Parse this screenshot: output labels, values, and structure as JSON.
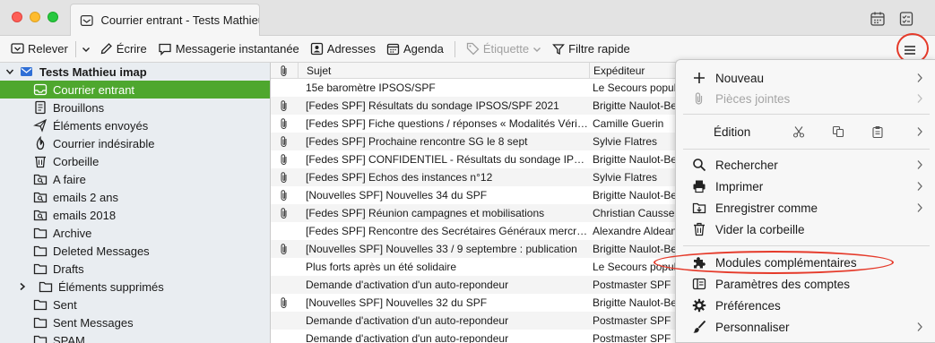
{
  "window": {
    "tab_title": "Courrier entrant - Tests Mathieu"
  },
  "toolbar": {
    "relever": "Relever",
    "ecrire": "Écrire",
    "messagerie": "Messagerie instantanée",
    "adresses": "Adresses",
    "agenda": "Agenda",
    "etiquette": "Étiquette",
    "filtre": "Filtre rapide"
  },
  "sidebar": {
    "account": "Tests Mathieu imap",
    "folders": [
      {
        "label": "Courrier entrant",
        "icon": "inbox-icon"
      },
      {
        "label": "Brouillons",
        "icon": "drafts-icon"
      },
      {
        "label": "Éléments envoyés",
        "icon": "sent-icon"
      },
      {
        "label": "Courrier indésirable",
        "icon": "junk-icon"
      },
      {
        "label": "Corbeille",
        "icon": "trash-icon"
      },
      {
        "label": "A faire",
        "icon": "saved-search-icon"
      },
      {
        "label": "emails 2 ans",
        "icon": "saved-search-icon"
      },
      {
        "label": "emails 2018",
        "icon": "saved-search-icon"
      },
      {
        "label": "Archive",
        "icon": "folder-icon"
      },
      {
        "label": "Deleted Messages",
        "icon": "folder-icon"
      },
      {
        "label": "Drafts",
        "icon": "folder-icon"
      },
      {
        "label": "Éléments supprimés",
        "icon": "folder-icon"
      },
      {
        "label": "Sent",
        "icon": "folder-icon"
      },
      {
        "label": "Sent Messages",
        "icon": "folder-icon"
      },
      {
        "label": "SPAM",
        "icon": "folder-icon"
      }
    ]
  },
  "list": {
    "col_subject": "Sujet",
    "col_from": "Expéditeur",
    "rows": [
      {
        "subject": "15e baromètre IPSOS/SPF",
        "from": "Le Secours populaire",
        "att": false
      },
      {
        "subject": "[Fedes SPF] Résultats du sondage IPSOS/SPF 2021",
        "from": "Brigitte Naulot-Bernard",
        "att": true
      },
      {
        "subject": "[Fedes SPF] Fiche questions / réponses « Modalités Vérification",
        "from": "Camille Guerin",
        "att": true
      },
      {
        "subject": "[Fedes SPF] Prochaine rencontre SG le 8 sept",
        "from": "Sylvie Flatres",
        "att": true
      },
      {
        "subject": "[Fedes SPF] CONFIDENTIEL - Résultats du sondage IPSOS",
        "from": "Brigitte Naulot-Bernard",
        "att": true
      },
      {
        "subject": "[Fedes SPF] Echos des instances n°12",
        "from": "Sylvie Flatres",
        "att": true
      },
      {
        "subject": "[Nouvelles SPF] Nouvelles 34 du SPF",
        "from": "Brigitte Naulot-Bernard",
        "att": true
      },
      {
        "subject": "[Fedes SPF] Réunion campagnes et mobilisations",
        "from": "Christian Causse",
        "att": true
      },
      {
        "subject": "[Fedes SPF] Rencontre des Secrétaires Généraux mercredi",
        "from": "Alexandre Aldeano",
        "att": false
      },
      {
        "subject": "[Nouvelles SPF] Nouvelles 33 / 9 septembre : publication",
        "from": "Brigitte Naulot-Bernard",
        "att": true
      },
      {
        "subject": "Plus forts après un été solidaire",
        "from": "Le Secours populaire",
        "att": false
      },
      {
        "subject": "Demande d'activation d'un auto-repondeur",
        "from": "Postmaster SPF",
        "att": false
      },
      {
        "subject": "[Nouvelles SPF] Nouvelles 32 du SPF",
        "from": "Brigitte Naulot-Bernard",
        "att": true
      },
      {
        "subject": "Demande d'activation d'un auto-repondeur",
        "from": "Postmaster SPF",
        "att": false
      },
      {
        "subject": "Demande d'activation d'un auto-repondeur",
        "from": "Postmaster SPF",
        "att": false
      }
    ]
  },
  "appmenu": {
    "nouveau": "Nouveau",
    "pieces_jointes": "Pièces jointes",
    "edition": "Édition",
    "rechercher": "Rechercher",
    "imprimer": "Imprimer",
    "enregistrer": "Enregistrer comme",
    "vider": "Vider la corbeille",
    "modules": "Modules complémentaires",
    "parametres": "Paramètres des comptes",
    "preferences": "Préférences",
    "personnaliser": "Personnaliser"
  },
  "colors": {
    "selected_folder": "#4ea72e",
    "highlight_ring": "#e53a2a"
  }
}
